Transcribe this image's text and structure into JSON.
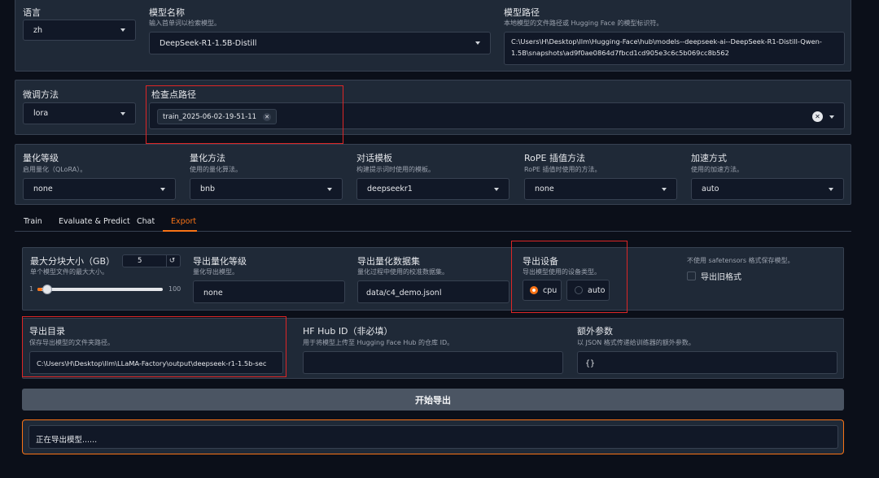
{
  "top": {
    "language": {
      "label": "语言",
      "value": "zh"
    },
    "model_name": {
      "label": "模型名称",
      "sub": "输入首单词以检索模型。",
      "value": "DeepSeek-R1-1.5B-Distill"
    },
    "model_path": {
      "label": "模型路径",
      "sub": "本地模型的文件路径或 Hugging Face 的模型标识符。",
      "value_line1": "C:\\Users\\H\\Desktop\\llm\\Hugging-Face\\hub\\models--deepseek-ai--DeepSeek-R1-Distill-Qwen-",
      "value_line2": "1.5B\\snapshots\\ad9f0ae0864d7fbcd1cd905e3c6c5b069cc8b562"
    }
  },
  "finetune": {
    "method": {
      "label": "微调方法",
      "value": "lora"
    },
    "checkpoint": {
      "label": "检查点路径",
      "tag": "train_2025-06-02-19-51-11"
    }
  },
  "quant": {
    "level": {
      "label": "量化等级",
      "sub": "启用量化（QLoRA）。",
      "value": "none"
    },
    "method": {
      "label": "量化方法",
      "sub": "使用的量化算法。",
      "value": "bnb"
    },
    "template": {
      "label": "对话模板",
      "sub": "构建提示词时使用的模板。",
      "value": "deepseekr1"
    },
    "rope": {
      "label": "RoPE 插值方法",
      "sub": "RoPE 插值时使用的方法。",
      "value": "none"
    },
    "accel": {
      "label": "加速方式",
      "sub": "使用的加速方法。",
      "value": "auto"
    }
  },
  "tabs": [
    {
      "label": "Train"
    },
    {
      "label": "Evaluate & Predict"
    },
    {
      "label": "Chat"
    },
    {
      "label": "Export"
    }
  ],
  "export": {
    "shard": {
      "label": "最大分块大小（GB）",
      "sub": "单个模型文件的最大大小。",
      "value": "5",
      "min": "1",
      "max": "100",
      "fraction": 0.04
    },
    "quant_bit": {
      "label": "导出量化等级",
      "sub": "量化导出模型。",
      "value": "none"
    },
    "dataset": {
      "label": "导出量化数据集",
      "sub": "量化过程中使用的校准数据集。",
      "value": "data/c4_demo.jsonl"
    },
    "device": {
      "label": "导出设备",
      "sub": "导出模型使用的设备类型。",
      "options": [
        "cpu",
        "auto"
      ],
      "selected": "cpu"
    },
    "legacy": {
      "sub": "不使用 safetensors 格式保存模型。",
      "label": "导出旧格式"
    },
    "dir": {
      "label": "导出目录",
      "sub": "保存导出模型的文件夹路径。",
      "value": "C:\\Users\\H\\Desktop\\llm\\LLaMA-Factory\\output\\deepseek-r1-1.5b-sec"
    },
    "hub": {
      "label": "HF Hub ID（非必填）",
      "sub": "用于将模型上传至 Hugging Face Hub 的仓库 ID。",
      "value": ""
    },
    "extra": {
      "label": "额外参数",
      "sub": "以 JSON 格式传递给训练器的额外参数。",
      "value": "{}"
    },
    "start_button": "开始导出",
    "status": "正在导出模型......"
  },
  "colors": {
    "accent": "#f97316",
    "highlight": "#dc2626",
    "panel": "#1f2937",
    "input": "#111827"
  }
}
